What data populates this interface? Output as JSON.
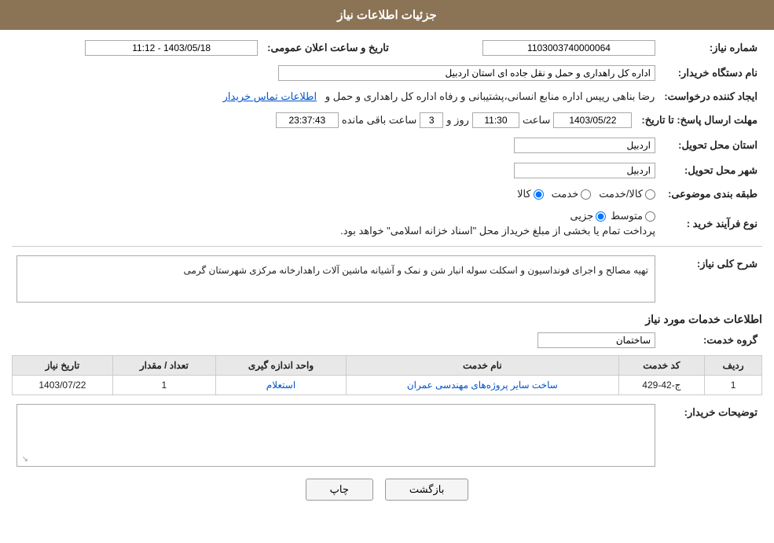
{
  "header": {
    "title": "جزئیات اطلاعات نیاز"
  },
  "fields": {
    "need_number_label": "شماره نیاز:",
    "need_number_value": "1103003740000064",
    "announcement_datetime_label": "تاریخ و ساعت اعلان عمومی:",
    "announcement_datetime_value": "1403/05/18 - 11:12",
    "buyer_label": "نام دستگاه خریدار:",
    "buyer_value": "اداره کل راهداری و حمل و نقل جاده ای استان اردبیل",
    "creator_label": "ایجاد کننده درخواست:",
    "creator_name": "رضا بناهی رییس اداره منابع انسانی،پشتیبانی و رفاه اداره کل راهداری و حمل و",
    "creator_contact_link": "اطلاعات تماس خریدار",
    "deadline_label": "مهلت ارسال پاسخ: تا تاریخ:",
    "deadline_date": "1403/05/22",
    "deadline_time_label": "ساعت",
    "deadline_time": "11:30",
    "deadline_day_label": "روز و",
    "deadline_days": "3",
    "deadline_remaining_label": "ساعت باقی مانده",
    "deadline_remaining": "23:37:43",
    "province_label": "استان محل تحویل:",
    "province_value": "اردبیل",
    "city_label": "شهر محل تحویل:",
    "city_value": "اردبیل",
    "category_label": "طبقه بندی موضوعی:",
    "category_kala": "کالا",
    "category_service": "خدمت",
    "category_kala_service": "کالا/خدمت",
    "process_type_label": "نوع فرآیند خرید :",
    "process_jozi": "جزیی",
    "process_motevasset": "متوسط",
    "process_desc": "پرداخت تمام یا بخشی از مبلغ خریداز محل \"اسناد خزانه اسلامی\" خواهد بود.",
    "need_description_label": "شرح کلی نیاز:",
    "need_description_value": "تهیه مصالح و اجرای فونداسیون و اسکلت سوله انبار شن و نمک و آشیانه ماشین آلات راهدارخانه مرکزی شهرستان گرمی",
    "service_info_label": "اطلاعات خدمات مورد نیاز",
    "service_group_label": "گروه خدمت:",
    "service_group_value": "ساختمان",
    "table": {
      "col_row": "ردیف",
      "col_code": "کد خدمت",
      "col_name": "نام خدمت",
      "col_unit": "واحد اندازه گیری",
      "col_quantity": "تعداد / مقدار",
      "col_date": "تاریخ نیاز",
      "rows": [
        {
          "row": "1",
          "code": "ج-42-429",
          "name": "ساخت سایر پروژه‌های مهندسی عمران",
          "unit": "استعلام",
          "quantity": "1",
          "date": "1403/07/22"
        }
      ]
    },
    "buyer_notes_label": "توضیحات خریدار:"
  },
  "buttons": {
    "print": "چاپ",
    "back": "بازگشت"
  },
  "colors": {
    "header_bg": "#8B7355",
    "link_color": "#0055cc"
  }
}
